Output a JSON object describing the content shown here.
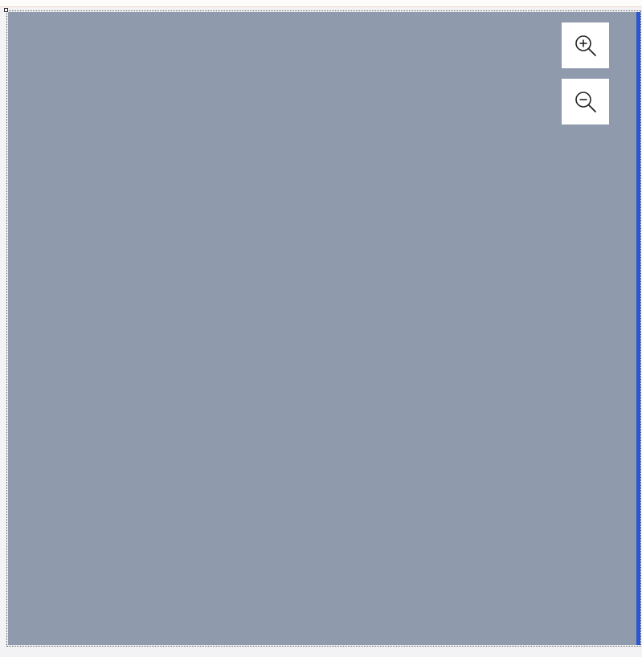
{
  "map": {
    "background_color": "#909aad",
    "edge_bar_color": "#2a55d4"
  },
  "controls": {
    "zoom_in": {
      "icon": "zoom-in-icon"
    },
    "zoom_out": {
      "icon": "zoom-out-icon"
    }
  }
}
